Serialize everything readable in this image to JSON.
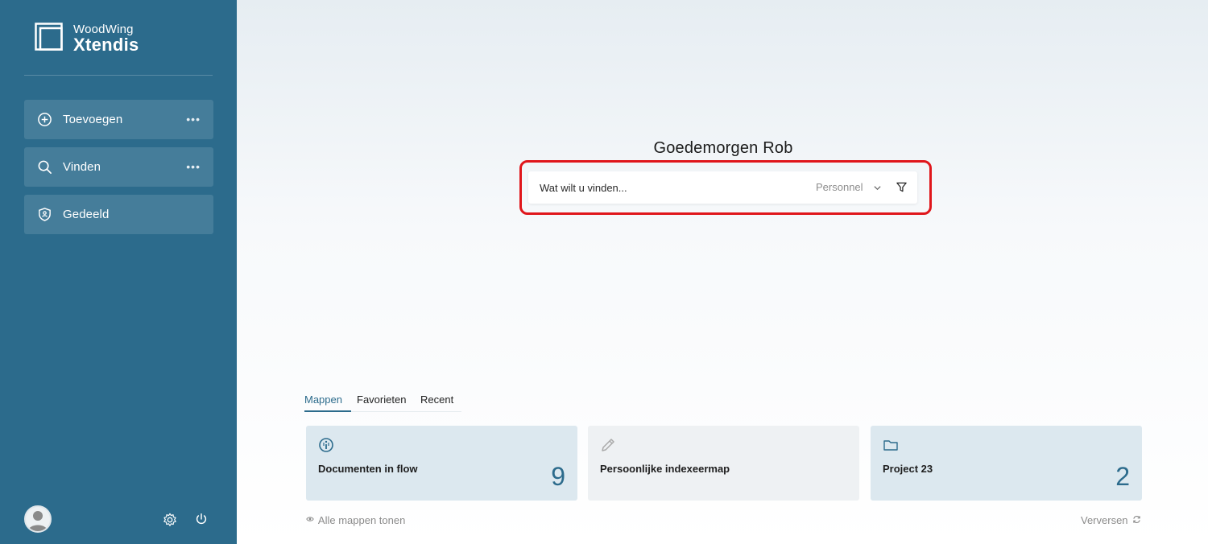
{
  "sidebar": {
    "logo": {
      "brand": "WoodWing",
      "product": "Xtendis"
    },
    "items": [
      {
        "label": "Toevoegen",
        "icon": "plus-circle-icon",
        "more": "•••"
      },
      {
        "label": "Vinden",
        "icon": "search-icon",
        "more": "•••"
      },
      {
        "label": "Gedeeld",
        "icon": "shield-icon"
      }
    ],
    "footer": {
      "avatar": "user-avatar-icon",
      "settings_icon": "gear-icon",
      "power_icon": "power-icon"
    }
  },
  "main": {
    "greeting": "Goedemorgen Rob",
    "search": {
      "placeholder": "Wat wilt u vinden...",
      "scope": "Personnel",
      "scope_icon": "chevron-down-icon",
      "filter_icon": "filter-icon",
      "highlight_color": "#e0161b"
    },
    "tabs": [
      {
        "label": "Mappen",
        "active": true
      },
      {
        "label": "Favorieten",
        "active": false
      },
      {
        "label": "Recent",
        "active": false
      }
    ],
    "cards": [
      {
        "title": "Documenten in flow",
        "count": "9",
        "icon": "info-circle-icon"
      },
      {
        "title": "Persoonlijke indexeermap",
        "count": "",
        "icon": "pencil-icon"
      },
      {
        "title": "Project 23",
        "count": "2",
        "icon": "folder-icon"
      }
    ],
    "show_all": "Alle mappen tonen",
    "refresh": "Verversen"
  },
  "colors": {
    "sidebar": "#2c6b8c",
    "accent": "#2c6b8c",
    "card_blue": "#dce8ef",
    "card_grey": "#eef1f3"
  }
}
